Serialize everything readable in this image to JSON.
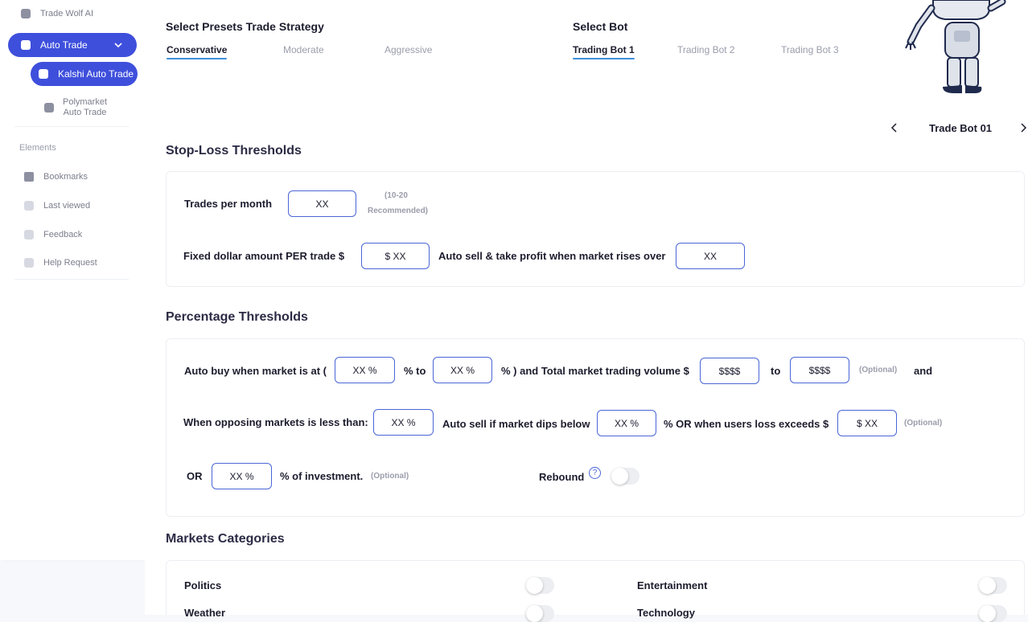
{
  "sidebar": {
    "top_item": "Trade Wolf AI",
    "auto_trade": "Auto Trade",
    "kalshi": "Kalshi Auto Trade",
    "polymarket_line1": "Polymarket",
    "polymarket_line2": "Auto Trade",
    "elements_label": "Elements",
    "items": [
      {
        "label": "Bookmarks",
        "icon": "bookmark-icon"
      },
      {
        "label": "Last viewed",
        "icon": "history-icon"
      },
      {
        "label": "Feedback",
        "icon": "feedback-icon"
      },
      {
        "label": "Help Request",
        "icon": "help-icon"
      }
    ]
  },
  "presets": {
    "title": "Select Presets Trade Strategy",
    "tabs": [
      "Conservative",
      "Moderate",
      "Aggressive"
    ],
    "active": "Conservative"
  },
  "bots": {
    "title": "Select Bot",
    "tabs": [
      "Trading Bot 1",
      "Trading Bot 2",
      "Trading Bot 3"
    ],
    "active": "Trading Bot 1",
    "carousel_label": "Trade Bot 01"
  },
  "stop_loss": {
    "title": "Stop-Loss Thresholds",
    "trades_label": "Trades per month",
    "trades_value": "XX",
    "recommended_line1": "(10-20",
    "recommended_line2": "Recommended)",
    "fixed_label": "Fixed dollar amount PER trade $",
    "fixed_value": "$ XX",
    "auto_sell_label": "Auto sell & take profit when market rises over",
    "auto_sell_value": "XX"
  },
  "percentage": {
    "title": "Percentage Thresholds",
    "auto_buy_label": "Auto buy when market is at (",
    "auto_buy_from": "XX %",
    "to_label": "% to",
    "auto_buy_to": "XX %",
    "volume_label": "% ) and Total market trading volume $",
    "volume_from": "$$$$",
    "volume_to_label": "to",
    "volume_to": "$$$$",
    "optional": "(Optional)",
    "and_label": "and",
    "opposing_label": "When opposing markets is less than:",
    "opposing_value": "XX %",
    "dips_label": "Auto sell if market dips below",
    "dips_value": "XX %",
    "or_loss_label": "%  OR  when users loss exceeds $",
    "loss_value": "$ XX",
    "or_label": "OR",
    "investment_value": "XX %",
    "investment_label": "% of investment.",
    "rebound_label": "Rebound",
    "rebound_help": "?"
  },
  "markets": {
    "title": "Markets Categories",
    "left": [
      "Politics",
      "Weather"
    ],
    "right": [
      "Entertainment",
      "Technology"
    ]
  },
  "colors": {
    "accent": "#3e4fdc",
    "field_border": "#4a66d6",
    "tab_underline": "#3e8fdc"
  }
}
